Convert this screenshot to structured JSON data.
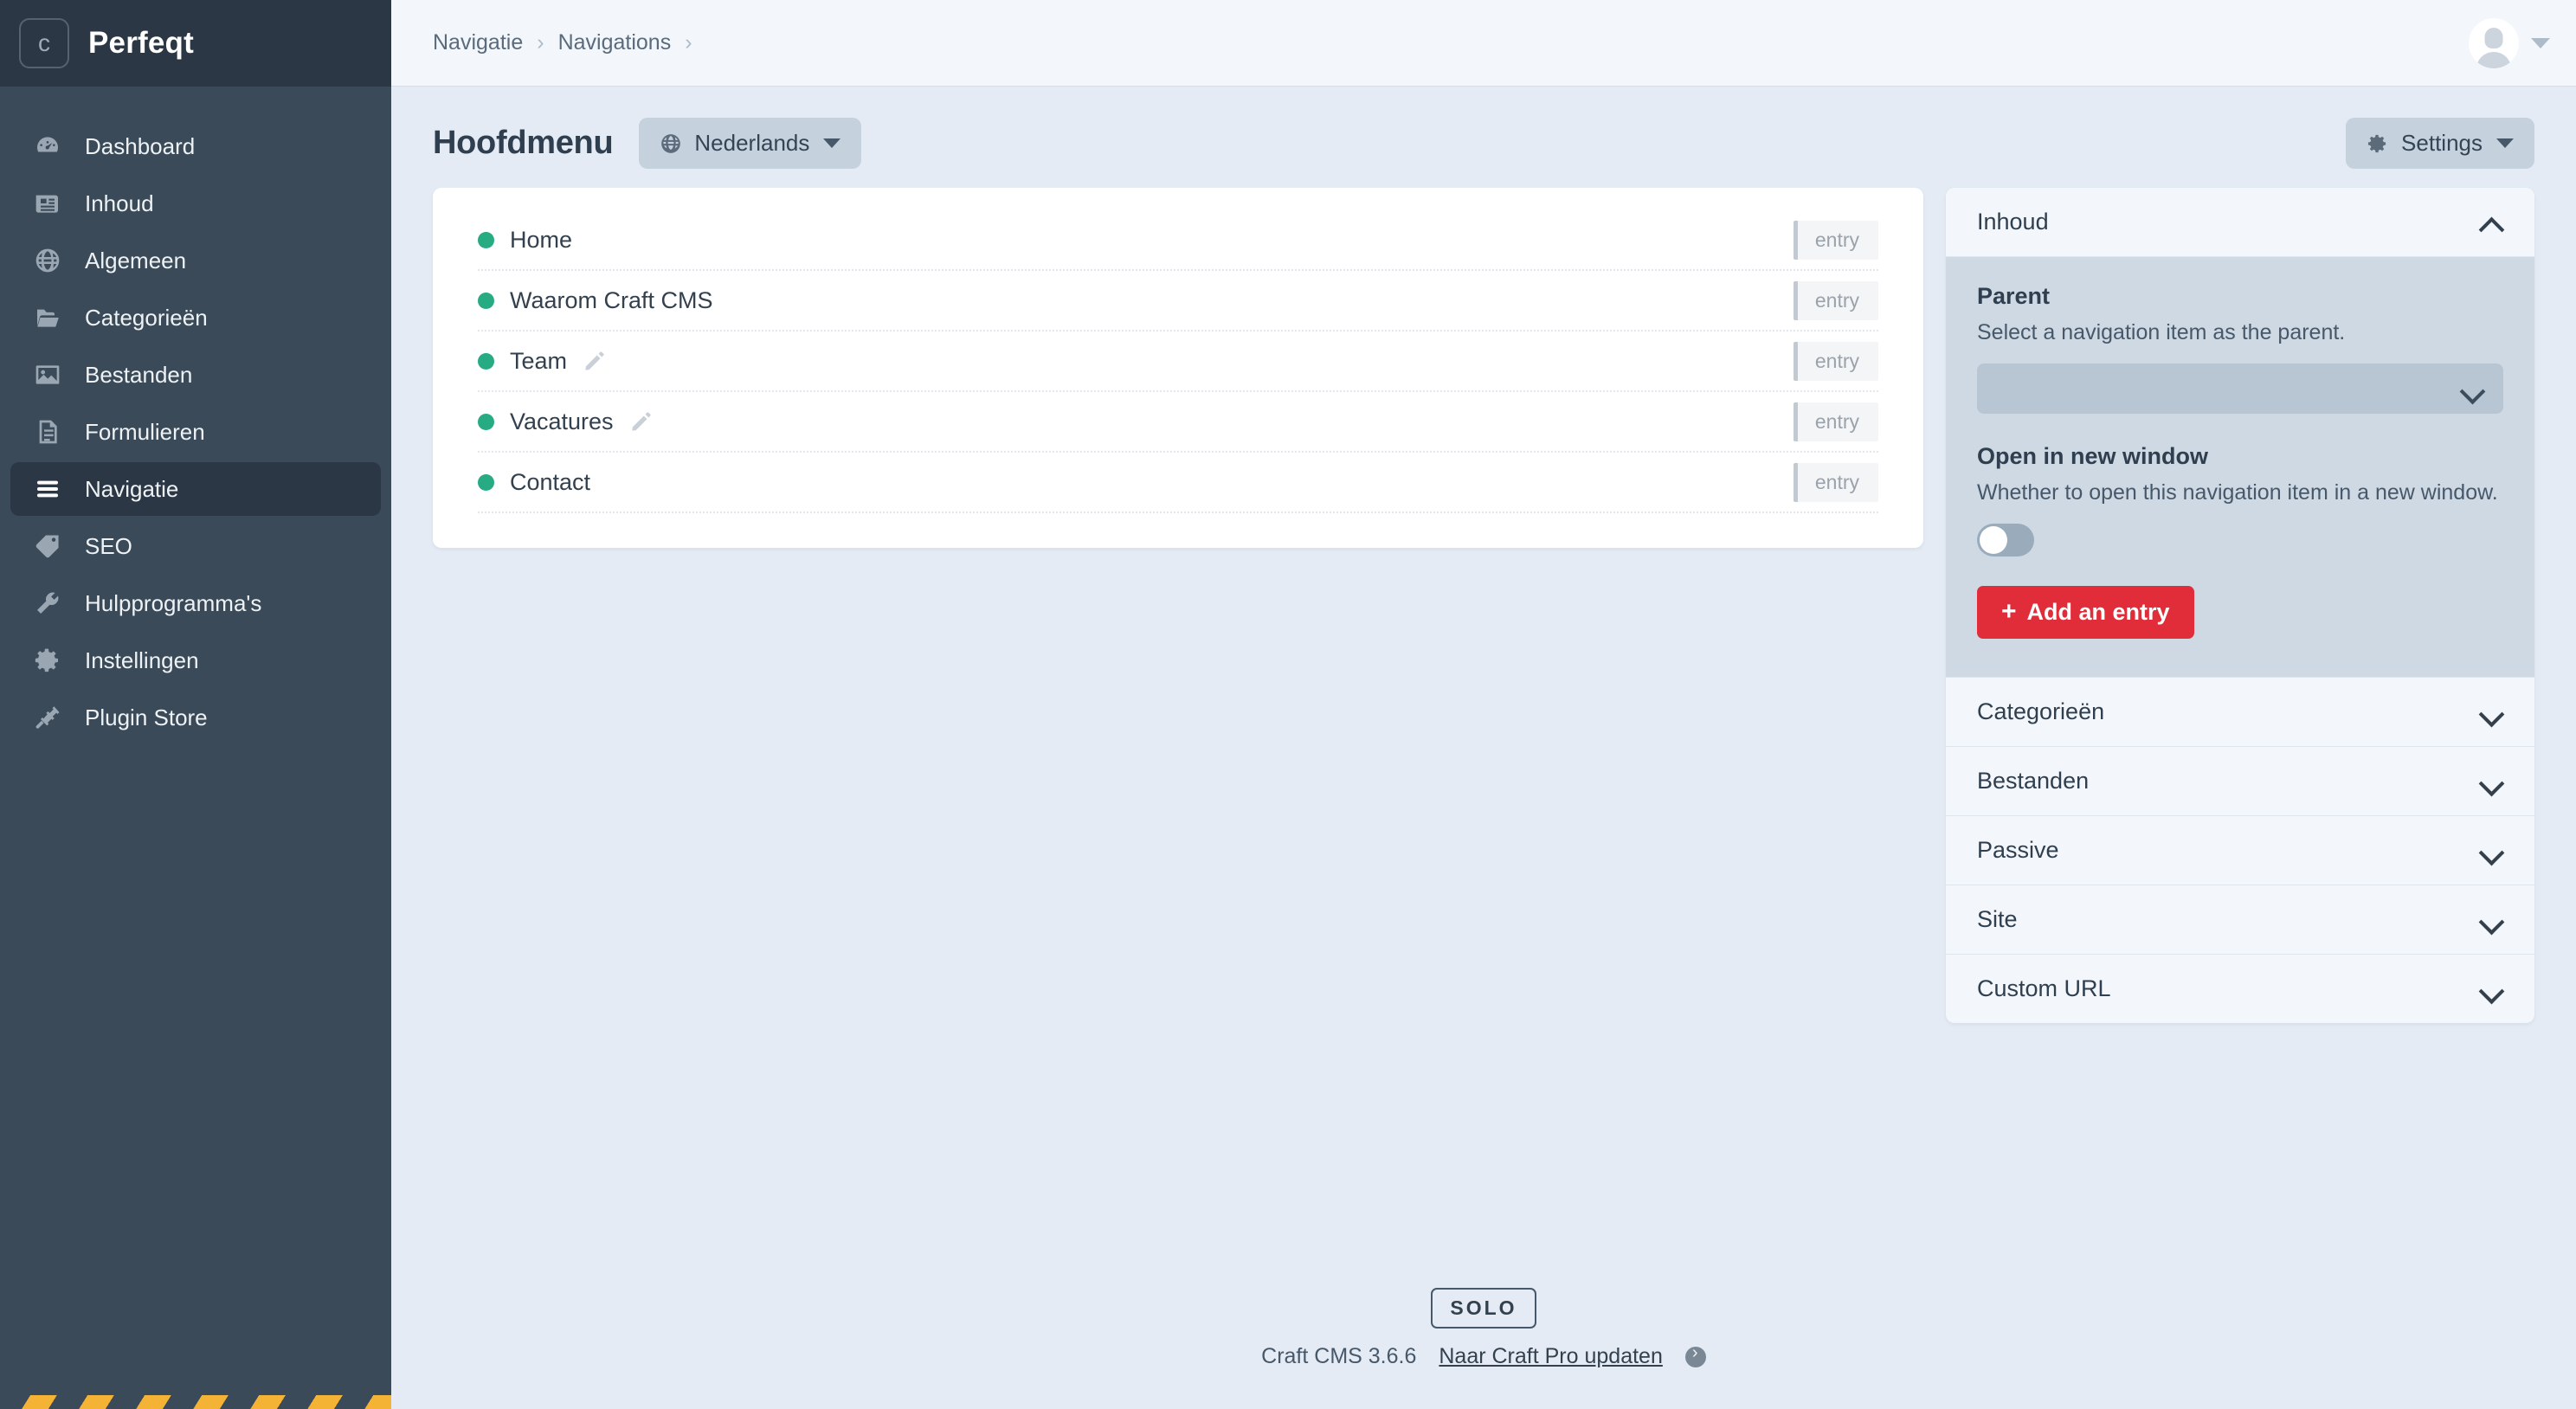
{
  "brand": {
    "badge_letter": "c",
    "name": "Perfeqt"
  },
  "sidebar": {
    "items": [
      {
        "label": "Dashboard",
        "icon": "dashboard-icon",
        "active": false
      },
      {
        "label": "Inhoud",
        "icon": "content-icon",
        "active": false
      },
      {
        "label": "Algemeen",
        "icon": "globe-icon",
        "active": false
      },
      {
        "label": "Categorieën",
        "icon": "folder-icon",
        "active": false
      },
      {
        "label": "Bestanden",
        "icon": "image-icon",
        "active": false
      },
      {
        "label": "Formulieren",
        "icon": "form-icon",
        "active": false
      },
      {
        "label": "Navigatie",
        "icon": "hamburger-icon",
        "active": true
      },
      {
        "label": "SEO",
        "icon": "tag-icon",
        "active": false
      },
      {
        "label": "Hulpprogramma's",
        "icon": "wrench-icon",
        "active": false
      },
      {
        "label": "Instellingen",
        "icon": "gear-icon",
        "active": false
      },
      {
        "label": "Plugin Store",
        "icon": "plug-icon",
        "active": false
      }
    ]
  },
  "topbar": {
    "breadcrumb": [
      "Navigatie",
      "Navigations"
    ],
    "separator": "›",
    "account_label": "account-menu"
  },
  "pagehead": {
    "title": "Hoofdmenu",
    "language_pill": {
      "label": "Nederlands",
      "icon": "globe-icon"
    },
    "settings_button": {
      "label": "Settings",
      "icon": "gear-icon"
    }
  },
  "nav_list": {
    "items": [
      {
        "label": "Home",
        "status": "enabled",
        "type_badge": "entry",
        "editable": false
      },
      {
        "label": "Waarom Craft CMS",
        "status": "enabled",
        "type_badge": "entry",
        "editable": false
      },
      {
        "label": "Team",
        "status": "enabled",
        "type_badge": "entry",
        "editable": true
      },
      {
        "label": "Vacatures",
        "status": "enabled",
        "type_badge": "entry",
        "editable": true
      },
      {
        "label": "Contact",
        "status": "enabled",
        "type_badge": "entry",
        "editable": false
      }
    ]
  },
  "panel": {
    "open_section": {
      "title": "Inhoud",
      "fields": {
        "parent": {
          "label": "Parent",
          "description": "Select a navigation item as the parent.",
          "value": ""
        },
        "new_window": {
          "label": "Open in new window",
          "description": "Whether to open this navigation item in a new window.",
          "enabled": false
        }
      },
      "add_button": {
        "label": "Add an entry",
        "plus": "+"
      }
    },
    "collapsed_sections": [
      {
        "label": "Categorieën"
      },
      {
        "label": "Bestanden"
      },
      {
        "label": "Passive"
      },
      {
        "label": "Site"
      },
      {
        "label": "Custom URL"
      }
    ]
  },
  "footer": {
    "edition_badge": "SOLO",
    "version": "Craft CMS 3.6.6",
    "upgrade_link": "Naar Craft Pro updaten"
  },
  "colors": {
    "sidebar_bg": "#3a4a59",
    "sidebar_dark": "#2b3744",
    "page_bg": "#e4ebf4",
    "accent_red": "#e12d39",
    "status_green": "#27ab83",
    "hazard_yellow": "#f5b335"
  }
}
